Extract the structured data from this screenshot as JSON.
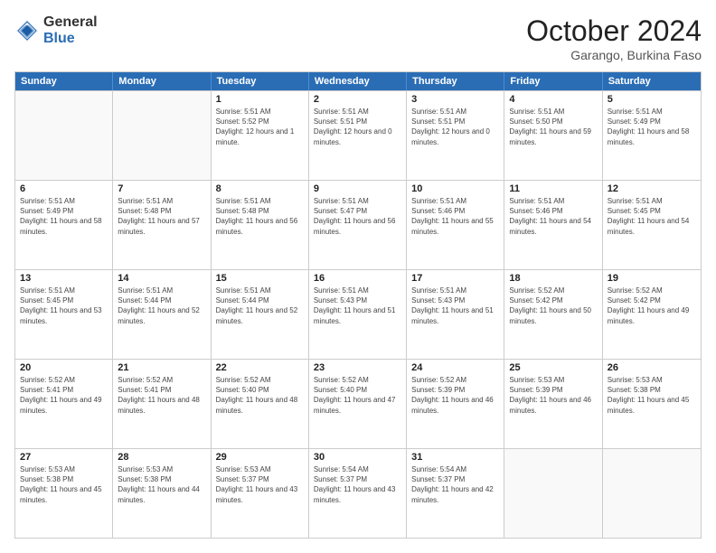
{
  "logo": {
    "general": "General",
    "blue": "Blue"
  },
  "title": "October 2024",
  "subtitle": "Garango, Burkina Faso",
  "header_days": [
    "Sunday",
    "Monday",
    "Tuesday",
    "Wednesday",
    "Thursday",
    "Friday",
    "Saturday"
  ],
  "weeks": [
    [
      {
        "day": "",
        "info": ""
      },
      {
        "day": "",
        "info": ""
      },
      {
        "day": "1",
        "info": "Sunrise: 5:51 AM\nSunset: 5:52 PM\nDaylight: 12 hours and 1 minute."
      },
      {
        "day": "2",
        "info": "Sunrise: 5:51 AM\nSunset: 5:51 PM\nDaylight: 12 hours and 0 minutes."
      },
      {
        "day": "3",
        "info": "Sunrise: 5:51 AM\nSunset: 5:51 PM\nDaylight: 12 hours and 0 minutes."
      },
      {
        "day": "4",
        "info": "Sunrise: 5:51 AM\nSunset: 5:50 PM\nDaylight: 11 hours and 59 minutes."
      },
      {
        "day": "5",
        "info": "Sunrise: 5:51 AM\nSunset: 5:49 PM\nDaylight: 11 hours and 58 minutes."
      }
    ],
    [
      {
        "day": "6",
        "info": "Sunrise: 5:51 AM\nSunset: 5:49 PM\nDaylight: 11 hours and 58 minutes."
      },
      {
        "day": "7",
        "info": "Sunrise: 5:51 AM\nSunset: 5:48 PM\nDaylight: 11 hours and 57 minutes."
      },
      {
        "day": "8",
        "info": "Sunrise: 5:51 AM\nSunset: 5:48 PM\nDaylight: 11 hours and 56 minutes."
      },
      {
        "day": "9",
        "info": "Sunrise: 5:51 AM\nSunset: 5:47 PM\nDaylight: 11 hours and 56 minutes."
      },
      {
        "day": "10",
        "info": "Sunrise: 5:51 AM\nSunset: 5:46 PM\nDaylight: 11 hours and 55 minutes."
      },
      {
        "day": "11",
        "info": "Sunrise: 5:51 AM\nSunset: 5:46 PM\nDaylight: 11 hours and 54 minutes."
      },
      {
        "day": "12",
        "info": "Sunrise: 5:51 AM\nSunset: 5:45 PM\nDaylight: 11 hours and 54 minutes."
      }
    ],
    [
      {
        "day": "13",
        "info": "Sunrise: 5:51 AM\nSunset: 5:45 PM\nDaylight: 11 hours and 53 minutes."
      },
      {
        "day": "14",
        "info": "Sunrise: 5:51 AM\nSunset: 5:44 PM\nDaylight: 11 hours and 52 minutes."
      },
      {
        "day": "15",
        "info": "Sunrise: 5:51 AM\nSunset: 5:44 PM\nDaylight: 11 hours and 52 minutes."
      },
      {
        "day": "16",
        "info": "Sunrise: 5:51 AM\nSunset: 5:43 PM\nDaylight: 11 hours and 51 minutes."
      },
      {
        "day": "17",
        "info": "Sunrise: 5:51 AM\nSunset: 5:43 PM\nDaylight: 11 hours and 51 minutes."
      },
      {
        "day": "18",
        "info": "Sunrise: 5:52 AM\nSunset: 5:42 PM\nDaylight: 11 hours and 50 minutes."
      },
      {
        "day": "19",
        "info": "Sunrise: 5:52 AM\nSunset: 5:42 PM\nDaylight: 11 hours and 49 minutes."
      }
    ],
    [
      {
        "day": "20",
        "info": "Sunrise: 5:52 AM\nSunset: 5:41 PM\nDaylight: 11 hours and 49 minutes."
      },
      {
        "day": "21",
        "info": "Sunrise: 5:52 AM\nSunset: 5:41 PM\nDaylight: 11 hours and 48 minutes."
      },
      {
        "day": "22",
        "info": "Sunrise: 5:52 AM\nSunset: 5:40 PM\nDaylight: 11 hours and 48 minutes."
      },
      {
        "day": "23",
        "info": "Sunrise: 5:52 AM\nSunset: 5:40 PM\nDaylight: 11 hours and 47 minutes."
      },
      {
        "day": "24",
        "info": "Sunrise: 5:52 AM\nSunset: 5:39 PM\nDaylight: 11 hours and 46 minutes."
      },
      {
        "day": "25",
        "info": "Sunrise: 5:53 AM\nSunset: 5:39 PM\nDaylight: 11 hours and 46 minutes."
      },
      {
        "day": "26",
        "info": "Sunrise: 5:53 AM\nSunset: 5:38 PM\nDaylight: 11 hours and 45 minutes."
      }
    ],
    [
      {
        "day": "27",
        "info": "Sunrise: 5:53 AM\nSunset: 5:38 PM\nDaylight: 11 hours and 45 minutes."
      },
      {
        "day": "28",
        "info": "Sunrise: 5:53 AM\nSunset: 5:38 PM\nDaylight: 11 hours and 44 minutes."
      },
      {
        "day": "29",
        "info": "Sunrise: 5:53 AM\nSunset: 5:37 PM\nDaylight: 11 hours and 43 minutes."
      },
      {
        "day": "30",
        "info": "Sunrise: 5:54 AM\nSunset: 5:37 PM\nDaylight: 11 hours and 43 minutes."
      },
      {
        "day": "31",
        "info": "Sunrise: 5:54 AM\nSunset: 5:37 PM\nDaylight: 11 hours and 42 minutes."
      },
      {
        "day": "",
        "info": ""
      },
      {
        "day": "",
        "info": ""
      }
    ]
  ]
}
